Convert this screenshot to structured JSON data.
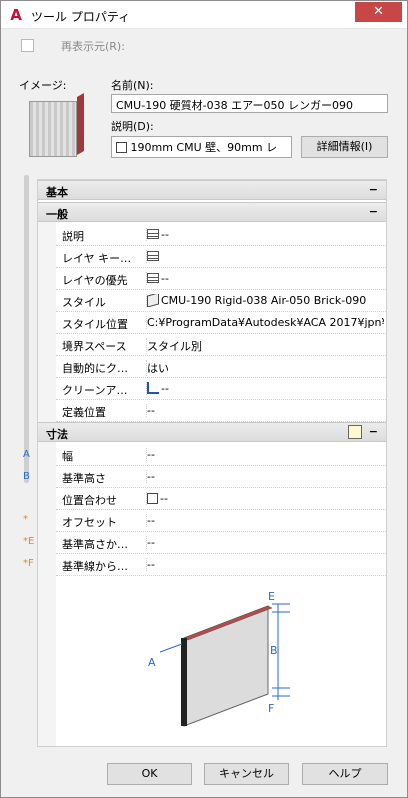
{
  "window": {
    "title": "ツール プロパティ",
    "close_glyph": "✕",
    "app_icon": "A"
  },
  "redisplay": {
    "label": "再表示元(R):"
  },
  "image_label": "イメージ:",
  "name": {
    "label": "名前(N):",
    "value": "CMU-190 硬質材-038 エアー050 レンガー090"
  },
  "desc": {
    "label": "説明(D):",
    "value": "190mm CMU 壁、90mm レ",
    "details_button": "詳細情報(I)"
  },
  "sections": {
    "basic": "基本",
    "general": "一般",
    "dims": "寸法",
    "collapse": "−"
  },
  "general_rows": [
    {
      "label": "説明",
      "icon": "grid-icon",
      "value": "--"
    },
    {
      "label": "レイヤ キー…",
      "icon": "grid-icon",
      "value": ""
    },
    {
      "label": "レイヤの優先",
      "icon": "grid-icon",
      "value": "--"
    },
    {
      "label": "スタイル",
      "icon": "wall-style-icon",
      "value": "CMU-190 Rigid-038 Air-050 Brick-090"
    },
    {
      "label": "スタイル位置",
      "icon": "",
      "value": "C:¥ProgramData¥Autodesk¥ACA  2017¥jpn¥…"
    },
    {
      "label": "境界スペース",
      "icon": "",
      "value": "スタイル別"
    },
    {
      "label": "自動的にク…",
      "icon": "",
      "value": "はい"
    },
    {
      "label": "クリーンア…",
      "icon": "cleanup-icon",
      "value": "--"
    },
    {
      "label": "定義位置",
      "icon": "",
      "value": "--"
    }
  ],
  "dim_rows": [
    {
      "mark": "A",
      "label": "幅",
      "value": "--"
    },
    {
      "mark": "B",
      "label": "基準高さ",
      "value": "--"
    },
    {
      "mark": "",
      "label": "位置合わせ",
      "value": "--"
    },
    {
      "mark": "*",
      "label": "オフセット",
      "value": "--"
    },
    {
      "mark": "*E",
      "label": "基準高さか…",
      "value": "--"
    },
    {
      "mark": "*F",
      "label": "基準線から…",
      "value": "--"
    }
  ],
  "diagram_labels": {
    "a": "A",
    "b": "B",
    "e": "E",
    "f": "F"
  },
  "buttons": {
    "ok": "OK",
    "cancel": "キャンセル",
    "help": "ヘルプ"
  }
}
